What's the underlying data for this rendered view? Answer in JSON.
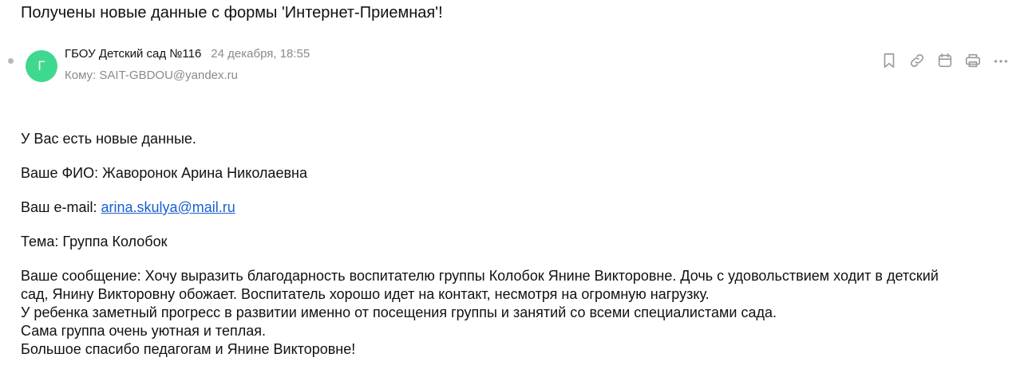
{
  "subject": "Получены новые данные с формы 'Интернет-Приемная'!",
  "sender": {
    "avatar_letter": "Г",
    "name": "ГБОУ Детский сад №116",
    "date": "24 декабря, 18:55",
    "recipient_label": "Кому:",
    "recipient": "SAIT-GBDOU@yandex.ru"
  },
  "toolbar": {
    "icons": [
      "bookmark-icon",
      "link-icon",
      "calendar-icon",
      "print-icon",
      "more-icon"
    ]
  },
  "body": {
    "intro": "У Вас есть новые данные.",
    "fio_label": "Ваше ФИО:",
    "fio_value": "Жаворонок Арина Николаевна",
    "email_label": "Ваш e-mail:",
    "email_value": "arina.skulya@mail.ru",
    "topic_label": "Тема:",
    "topic_value": "Группа Колобок",
    "message_label": "Ваше сообщение:",
    "message_line1": "Хочу выразить благодарность воспитателю группы Колобок Янине Викторовне. Дочь с удовольствием ходит в детский",
    "message_line2": "сад, Янину Викторовну обожает. Воспитатель хорошо идет на контакт, несмотря на огромную нагрузку.",
    "message_line3": "У ребенка заметный прогресс в развитии именно от посещения группы и занятий со всеми специалистами сада.",
    "message_line4": "Сама группа очень уютная и теплая.",
    "message_line5": "Большое спасибо педагогам и Янине Викторовне!"
  },
  "colors": {
    "avatar": "#3ed98f",
    "link": "#1a5fd0",
    "muted": "#8a8a8a",
    "icon": "#9a9a9a"
  }
}
